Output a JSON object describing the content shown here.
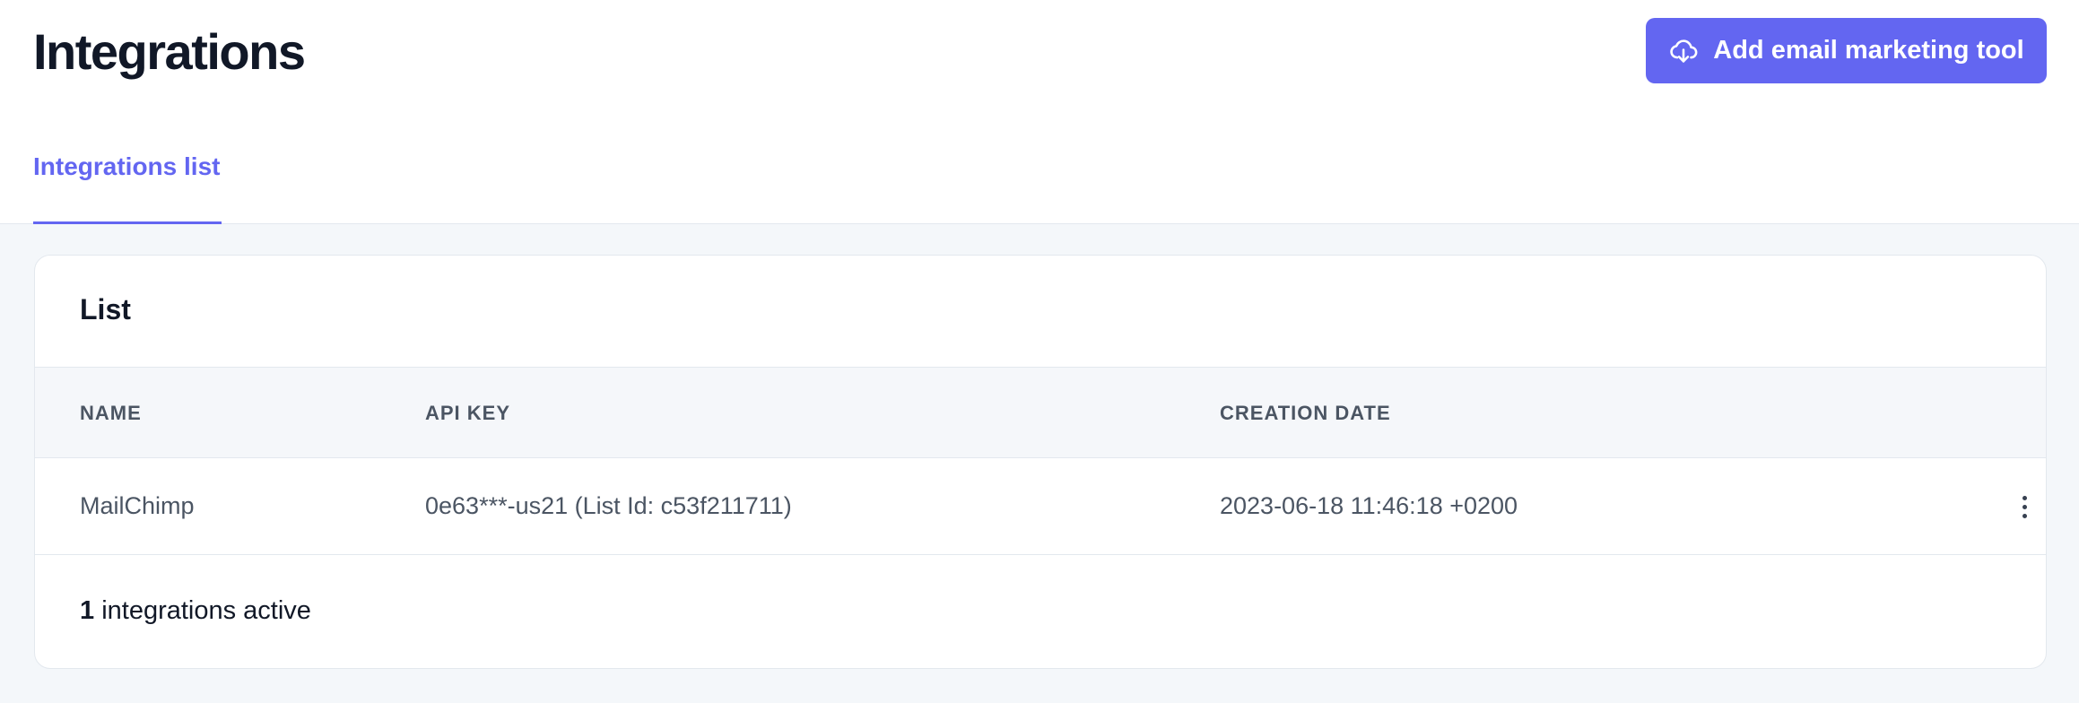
{
  "header": {
    "title": "Integrations",
    "add_button_label": "Add email marketing tool",
    "add_button_icon": "cloud-download-icon",
    "accent_color": "#6366f1"
  },
  "tabs": [
    {
      "label": "Integrations list",
      "active": true
    }
  ],
  "card": {
    "title": "List",
    "columns": [
      "NAME",
      "API KEY",
      "CREATION DATE"
    ],
    "rows": [
      {
        "name": "MailChimp",
        "api_key": "0e63***-us21 (List Id: c53f211711)",
        "creation_date": "2023-06-18 11:46:18 +0200",
        "menu_icon": "more-vertical-icon"
      }
    ],
    "footer": {
      "count": "1",
      "text": " integrations active"
    }
  }
}
